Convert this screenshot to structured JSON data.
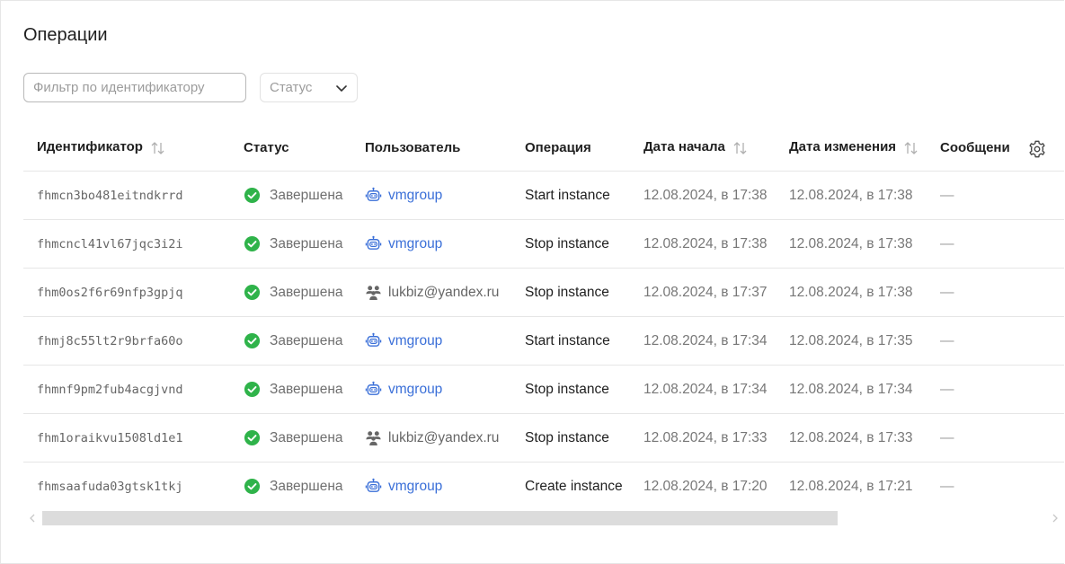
{
  "page": {
    "title": "Операции"
  },
  "filters": {
    "id_placeholder": "Фильтр по идентификатору",
    "status_placeholder": "Статус"
  },
  "table": {
    "headers": {
      "id": "Идентификатор",
      "status": "Статус",
      "user": "Пользователь",
      "operation": "Операция",
      "start_date": "Дата начала",
      "modified_date": "Дата изменения",
      "messages": "Сообщени"
    },
    "rows": [
      {
        "id": "fhmcn3bo481eitndkrrd",
        "status": "Завершена",
        "user": "vmgroup",
        "user_type": "service-account",
        "operation": "Start instance",
        "start": "12.08.2024, в 17:38",
        "modified": "12.08.2024, в 17:38",
        "message": "—"
      },
      {
        "id": "fhmcncl41vl67jqc3i2i",
        "status": "Завершена",
        "user": "vmgroup",
        "user_type": "service-account",
        "operation": "Stop instance",
        "start": "12.08.2024, в 17:38",
        "modified": "12.08.2024, в 17:38",
        "message": "—"
      },
      {
        "id": "fhm0os2f6r69nfp3gpjq",
        "status": "Завершена",
        "user": "lukbiz@yandex.ru",
        "user_type": "federated-user",
        "operation": "Stop instance",
        "start": "12.08.2024, в 17:37",
        "modified": "12.08.2024, в 17:38",
        "message": "—"
      },
      {
        "id": "fhmj8c55lt2r9brfa60o",
        "status": "Завершена",
        "user": "vmgroup",
        "user_type": "service-account",
        "operation": "Start instance",
        "start": "12.08.2024, в 17:34",
        "modified": "12.08.2024, в 17:35",
        "message": "—"
      },
      {
        "id": "fhmnf9pm2fub4acgjvnd",
        "status": "Завершена",
        "user": "vmgroup",
        "user_type": "service-account",
        "operation": "Stop instance",
        "start": "12.08.2024, в 17:34",
        "modified": "12.08.2024, в 17:34",
        "message": "—"
      },
      {
        "id": "fhm1oraikvu1508ld1e1",
        "status": "Завершена",
        "user": "lukbiz@yandex.ru",
        "user_type": "federated-user",
        "operation": "Stop instance",
        "start": "12.08.2024, в 17:33",
        "modified": "12.08.2024, в 17:33",
        "message": "—"
      },
      {
        "id": "fhmsaafuda03gtsk1tkj",
        "status": "Завершена",
        "user": "vmgroup",
        "user_type": "service-account",
        "operation": "Create instance",
        "start": "12.08.2024, в 17:20",
        "modified": "12.08.2024, в 17:21",
        "message": "—"
      }
    ]
  },
  "icons": {
    "success": "check-circle-icon",
    "service_account": "robot-icon",
    "federated_user": "users-icon",
    "sort": "sort-icon",
    "settings": "gear-icon",
    "dropdown": "chevron-down-icon"
  },
  "colors": {
    "success": "#2fb34a",
    "link": "#3a6fd8",
    "scroll_thumb": "#dcdcdc"
  }
}
